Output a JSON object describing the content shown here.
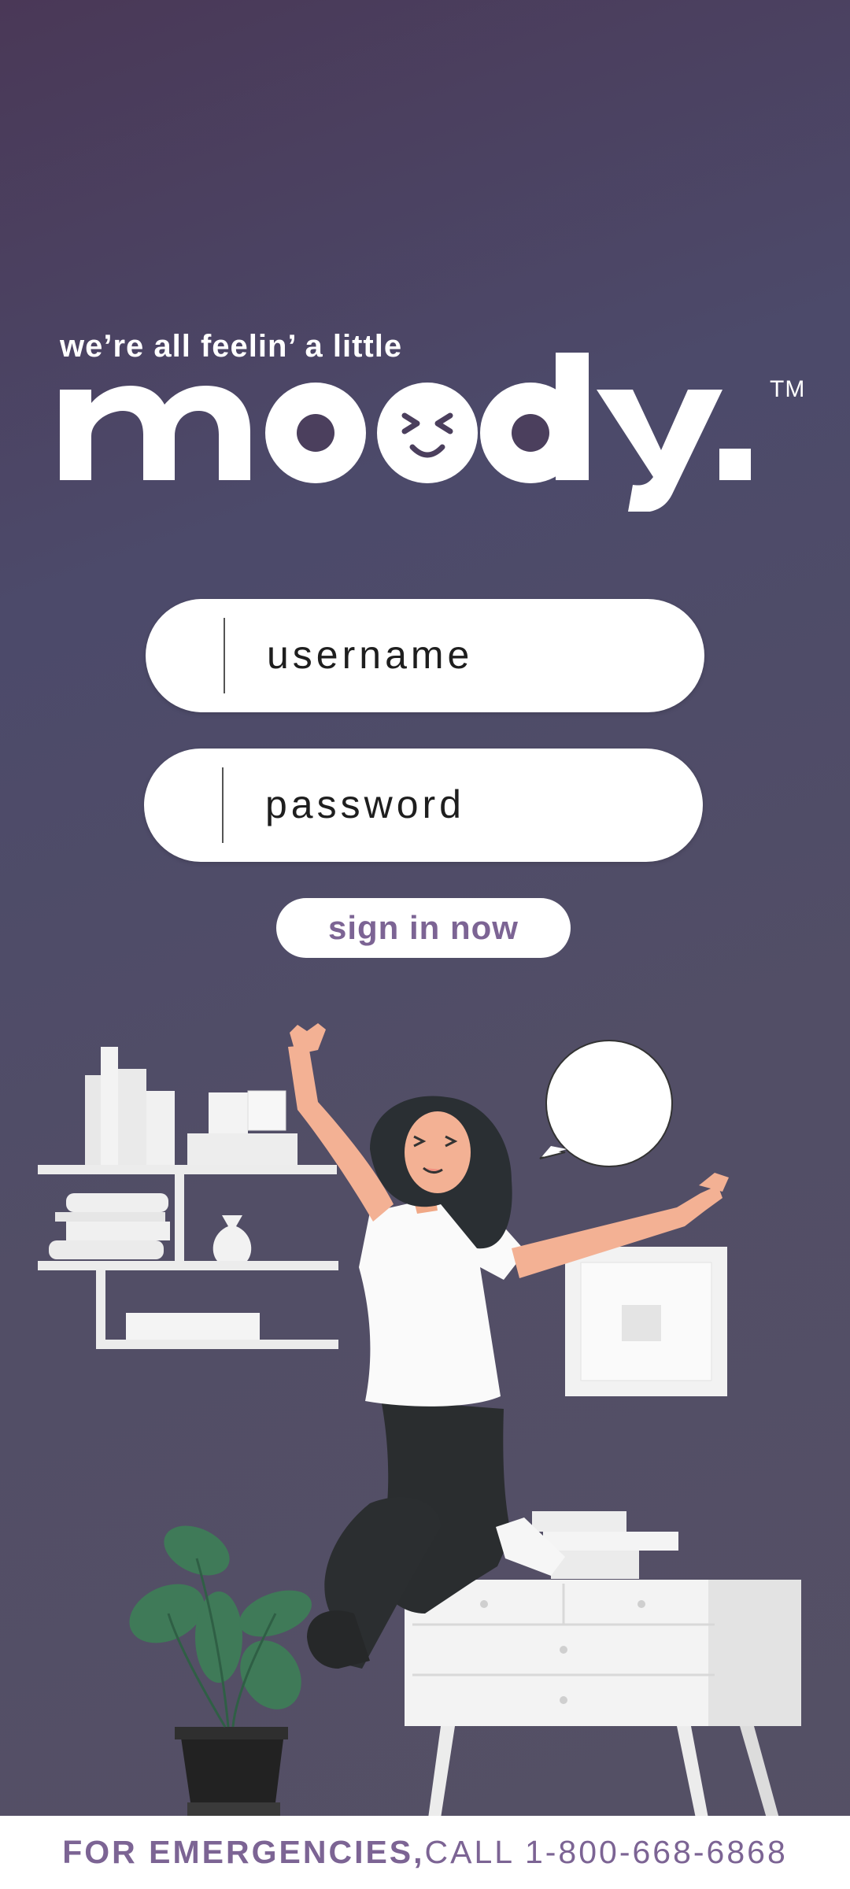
{
  "app": {
    "tagline": "we’re all feelin’ a little",
    "brand_name": "moody.",
    "trademark": "TM"
  },
  "login": {
    "username_placeholder": "username",
    "password_placeholder": "password",
    "signin_label": "sign in now"
  },
  "footer": {
    "emergency_prefix": "FOR EMERGENCIES,",
    "emergency_call": " CALL 1-800-668-6868"
  },
  "colors": {
    "accent": "#7c6494",
    "background_top": "#4a3857",
    "background_bottom": "#555065",
    "surface": "#ffffff"
  },
  "icons": {
    "logo_face": "winking-smile-icon",
    "speech": "speech-bubble-icon"
  }
}
